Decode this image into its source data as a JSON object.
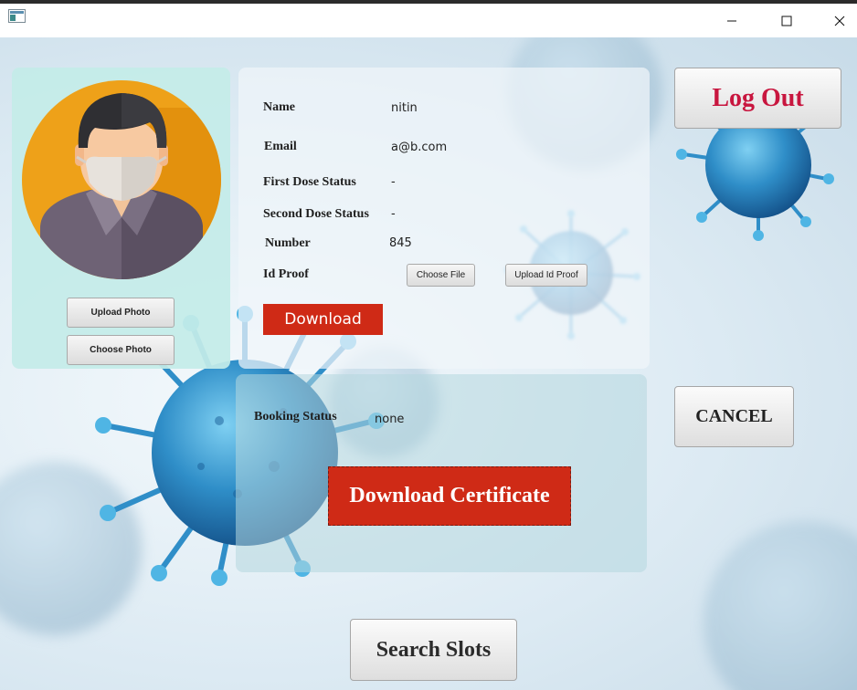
{
  "window": {
    "app_icon": "java-app-icon",
    "controls": [
      "minimize-icon",
      "maximize-icon",
      "close-icon"
    ]
  },
  "profile": {
    "avatar_icon": "masked-user-avatar",
    "upload_photo_label": "Upload Photo",
    "choose_photo_label": "Choose Photo"
  },
  "info": {
    "name_label": "Name",
    "name_value": "nitin",
    "email_label": "Email",
    "email_value": "a@b.com",
    "first_dose_label": "First Dose Status",
    "first_dose_value": "-",
    "second_dose_label": "Second Dose Status",
    "second_dose_value": "-",
    "number_label": "Number",
    "number_value": "845",
    "id_proof_label": "Id Proof",
    "choose_file_label": "Choose File",
    "upload_id_label": "Upload Id Proof",
    "download_label": "Download"
  },
  "booking": {
    "status_label": "Booking Status",
    "status_value": "none",
    "download_certificate_label": "Download Certificate"
  },
  "actions": {
    "logout_label": "Log Out",
    "cancel_label": "CANCEL",
    "search_slots_label": "Search Slots"
  },
  "colors": {
    "red_button": "#cf2a16",
    "logout_text": "#c8163f",
    "left_panel": "#c4ece8",
    "virus_blue": "#2f8ec8"
  }
}
